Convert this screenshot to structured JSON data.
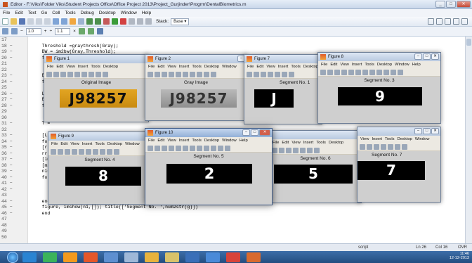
{
  "window": {
    "title": "Editor - F:\\Viks\\Folder Viks\\Student Projects Office\\Office Project 2013\\Project_Gurjinder\\Progrm\\DentalBiometrics.m"
  },
  "menubar": [
    "File",
    "Edit",
    "Text",
    "Go",
    "Cell",
    "Tools",
    "Debug",
    "Desktop",
    "Window",
    "Help"
  ],
  "toolbar": {
    "stack_label": "Stack:",
    "stack_value": "Base"
  },
  "toolbar2": {
    "minus": "−",
    "cell_a": "1.0",
    "plus": "+",
    "divide": "÷",
    "cell_b": "1.1",
    "times": "×"
  },
  "editor": {
    "lines": [
      {
        "n": "17",
        "t": ""
      },
      {
        "n": "18 −",
        "t": "    Threshold =graythresh(Gray);"
      },
      {
        "n": "19 −",
        "t": "    BW = im2bw(Gray,Threshold);"
      },
      {
        "n": "20 −",
        "t": "    figure,"
      },
      {
        "n": "21",
        "t": ""
      },
      {
        "n": "22",
        "t": ""
      },
      {
        "n": "23 −",
        "t": "    BW ="
      },
      {
        "n": "24 −",
        "t": "    figu"
      },
      {
        "n": "25",
        "t": ""
      },
      {
        "n": "26 −",
        "t": "    Left"
      },
      {
        "n": "27 −",
        "t": "    BW1"
      },
      {
        "n": "28 −",
        "t": "    figu"
      },
      {
        "n": "29",
        "t": ""
      },
      {
        "n": "30",
        "t": ""
      },
      {
        "n": "31 −",
        "t": "    T ="
      },
      {
        "n": "32",
        "t": ""
      },
      {
        "n": "33 −",
        "t": "    [L1,"
      },
      {
        "n": "34 −",
        "t": "    for"
      },
      {
        "n": "35 −",
        "t": "    [r,c"
      },
      {
        "n": "36 −",
        "t": "    rr ="
      },
      {
        "n": "37 −",
        "t": "    [ime"
      },
      {
        "n": "38 −",
        "t": "    [mx"
      },
      {
        "n": "39 −",
        "t": "    n1=n"
      },
      {
        "n": "40 −",
        "t": "    for"
      },
      {
        "n": "41 −",
        "t": ""
      },
      {
        "n": "42 −",
        "t": ""
      },
      {
        "n": "43",
        "t": ""
      },
      {
        "n": "44 −",
        "t": "    end"
      },
      {
        "n": "45 −",
        "t": "    figure, imshow(n1,[]); title(['Segment No. ',num2str(g)])"
      },
      {
        "n": "46 −",
        "t": "    end"
      },
      {
        "n": "47",
        "t": ""
      },
      {
        "n": "48",
        "t": ""
      },
      {
        "n": "49",
        "t": ""
      },
      {
        "n": "50",
        "t": ""
      }
    ]
  },
  "status": {
    "mode": "script",
    "ln": "Ln  26",
    "col": "Col  16",
    "ovr": "OVR"
  },
  "tray": {
    "time": "11:46",
    "date": "12-12-2013"
  },
  "figure_menu": [
    "File",
    "Edit",
    "View",
    "Insert",
    "Tools",
    "Desktop",
    "Window",
    "Help"
  ],
  "figures": [
    {
      "title": "Figure 1",
      "caption": "Original Image",
      "content": "J98257"
    },
    {
      "title": "Figure 2",
      "caption": "Gray Image",
      "content": "J98257"
    },
    {
      "title": "Figure 7",
      "caption": "Segment No. 1",
      "content": "J"
    },
    {
      "title": "Figure 8",
      "caption": "Segment No. 3",
      "content": "9"
    },
    {
      "title": "Figure 9",
      "caption": "Segment No. 4",
      "content": "8"
    },
    {
      "title": "Figure 10",
      "caption": "Segment No. 5",
      "content": "2"
    },
    {
      "title": "",
      "caption": "Segment No. 6",
      "content": "5"
    },
    {
      "title": "",
      "caption": "Segment No. 7",
      "content": "7"
    }
  ]
}
